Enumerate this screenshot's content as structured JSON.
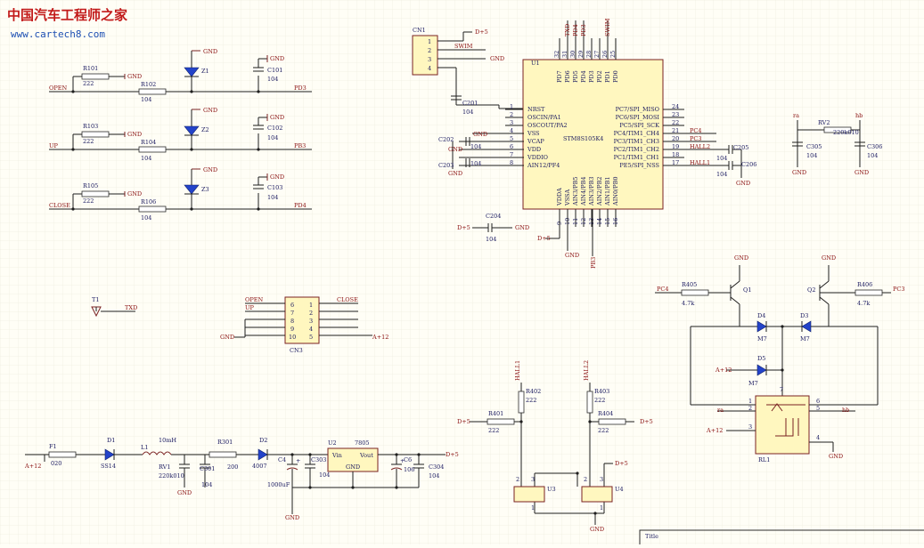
{
  "watermark": {
    "cn": "中国汽车工程师之家",
    "url": "www.cartech8.com"
  },
  "title_block": {
    "label": "Title"
  },
  "mcu": {
    "ref": "U1",
    "name": "STM8S105K4",
    "left_pins": [
      {
        "num": "1",
        "name": "NRST"
      },
      {
        "num": "2",
        "name": "OSCIN/PA1"
      },
      {
        "num": "3",
        "name": "OSCOUT/PA2"
      },
      {
        "num": "4",
        "name": "VSS"
      },
      {
        "num": "5",
        "name": "VCAP"
      },
      {
        "num": "6",
        "name": "VDD"
      },
      {
        "num": "7",
        "name": "VDDIO"
      },
      {
        "num": "8",
        "name": "AIN12/PF4"
      }
    ],
    "right_pins": [
      {
        "num": "24",
        "name": "PC7/SPI_MISO",
        "net": ""
      },
      {
        "num": "23",
        "name": "PC6/SPI_MOSI",
        "net": ""
      },
      {
        "num": "22",
        "name": "PC5/SPI_SCK",
        "net": ""
      },
      {
        "num": "21",
        "name": "PC4/TIM1_CH4",
        "net": "PC4"
      },
      {
        "num": "20",
        "name": "PC3/TIM1_CH3",
        "net": "PC3"
      },
      {
        "num": "19",
        "name": "PC2/TIM1_CH2",
        "net": "HALL2"
      },
      {
        "num": "18",
        "name": "PC1/TIM1_CH1",
        "net": ""
      },
      {
        "num": "17",
        "name": "PE5/SPI_NSS",
        "net": "HALL1"
      }
    ],
    "top_pins": [
      {
        "num": "32",
        "name": "PD7",
        "net": ""
      },
      {
        "num": "31",
        "name": "PD6",
        "net": "TXD"
      },
      {
        "num": "30",
        "name": "PD5",
        "net": "PD4"
      },
      {
        "num": "29",
        "name": "PD4",
        "net": "PD3"
      },
      {
        "num": "28",
        "name": "PD3",
        "net": ""
      },
      {
        "num": "27",
        "name": "PD2",
        "net": ""
      },
      {
        "num": "26",
        "name": "PD1",
        "net": "SWIM"
      },
      {
        "num": "25",
        "name": "PD0",
        "net": ""
      }
    ],
    "bottom_pins": [
      {
        "num": "9",
        "name": "VDDA"
      },
      {
        "num": "10",
        "name": "VSSA"
      },
      {
        "num": "11",
        "name": "AIN3/PB5"
      },
      {
        "num": "12",
        "name": "AIN4/PB4"
      },
      {
        "num": "13",
        "name": "AIN3/PB3"
      },
      {
        "num": "14",
        "name": "AIN2/PB2"
      },
      {
        "num": "15",
        "name": "AIN1/PB1"
      },
      {
        "num": "16",
        "name": "AIN0/PB0"
      }
    ],
    "bottom_net": "PB3"
  },
  "inputs": [
    {
      "net": "OPEN",
      "r1": "R101",
      "r1v": "222",
      "r2": "R102",
      "r2v": "104",
      "z": "Z1",
      "c": "C101",
      "cv": "104",
      "out": "PD3",
      "gnd": "GND"
    },
    {
      "net": "UP",
      "r1": "R103",
      "r1v": "222",
      "r2": "R104",
      "r2v": "104",
      "z": "Z2",
      "c": "C102",
      "cv": "104",
      "out": "PB3",
      "gnd": "GND"
    },
    {
      "net": "CLOSE",
      "r1": "R105",
      "r1v": "222",
      "r2": "R106",
      "r2v": "104",
      "z": "Z3",
      "c": "C103",
      "cv": "104",
      "out": "PD4",
      "gnd": "GND"
    }
  ],
  "swim_conn": {
    "ref": "CN1",
    "pins": [
      "1",
      "2",
      "3",
      "4"
    ],
    "net_d5": "D+5",
    "net_swim": "SWIM",
    "net_gnd": "GND",
    "c201": "C201",
    "c201v": "104"
  },
  "mcu_caps": [
    {
      "ref": "C202",
      "val": "104",
      "gnd": "GND"
    },
    {
      "ref": "C203",
      "val": "104",
      "gnd": "GND"
    },
    {
      "ref": "C204",
      "val": "104",
      "d5": "D+5",
      "gnd": "GND"
    },
    {
      "ref": "C205",
      "val": "104",
      "gnd": "GND"
    },
    {
      "ref": "C206",
      "val": "104",
      "gnd": "GND"
    }
  ],
  "rv2": {
    "ref": "RV2",
    "val": "220k010",
    "c305": "C305",
    "c305v": "104",
    "c306": "C306",
    "c306v": "104",
    "n_left": "ra",
    "n_right": "hb",
    "gnd": "GND"
  },
  "tx": {
    "ref": "T1",
    "net": "TXD"
  },
  "cn3": {
    "ref": "CN3",
    "left_pins": [
      "6",
      "7",
      "8",
      "9",
      "10"
    ],
    "right_pins": [
      "1",
      "2",
      "3",
      "4",
      "5"
    ],
    "net_open": "OPEN",
    "net_up": "UP",
    "net_close": "CLOSE",
    "net_gnd": "GND",
    "net_a12": "A+12"
  },
  "power": {
    "in": "A+12",
    "f1": "F1",
    "f1v": "020",
    "d1": "D1",
    "d1v": "SS14",
    "l1": "L1",
    "l1v": "10mH",
    "rv1": "RV1",
    "rv1v": "220k010",
    "c301": "C301",
    "c301v": "104",
    "r301": "R301",
    "r301v": "200",
    "d2": "D2",
    "d2v": "4007",
    "c4": "C4",
    "c4v": "1000uF",
    "c303": "C303",
    "c303v": "104",
    "reg": "U2",
    "regv": "7805",
    "vin": "Vin",
    "vout": "Vout",
    "reg_gnd": "GND",
    "c6": "C6",
    "c6v": "106",
    "c304": "C304",
    "c304v": "104",
    "out": "D+5",
    "gnd": "GND",
    "plus": "+"
  },
  "hall": {
    "net1": "HALL1",
    "net2": "HALL2",
    "r401": "R401",
    "r401v": "222",
    "r402": "R402",
    "r402v": "222",
    "r403": "R403",
    "r403v": "222",
    "r404": "R404",
    "r404v": "222",
    "u3": "U3",
    "u4": "U4",
    "d5": "D+5",
    "gnd": "GND",
    "pins": [
      "1",
      "2",
      "3"
    ]
  },
  "relay": {
    "q1": "Q1",
    "q2": "Q2",
    "r405": "R405",
    "r405v": "4.7k",
    "r406": "R406",
    "r406v": "4.7k",
    "pc4": "PC4",
    "pc3": "PC3",
    "d3": "D3",
    "d4": "D4",
    "d5": "D5",
    "dv": "M7",
    "a12": "A+12",
    "gnd": "GND",
    "rl1": "RL1",
    "ra": "ra",
    "hb": "hb",
    "pins": [
      "1",
      "2",
      "3",
      "4",
      "5",
      "6",
      "7"
    ]
  }
}
